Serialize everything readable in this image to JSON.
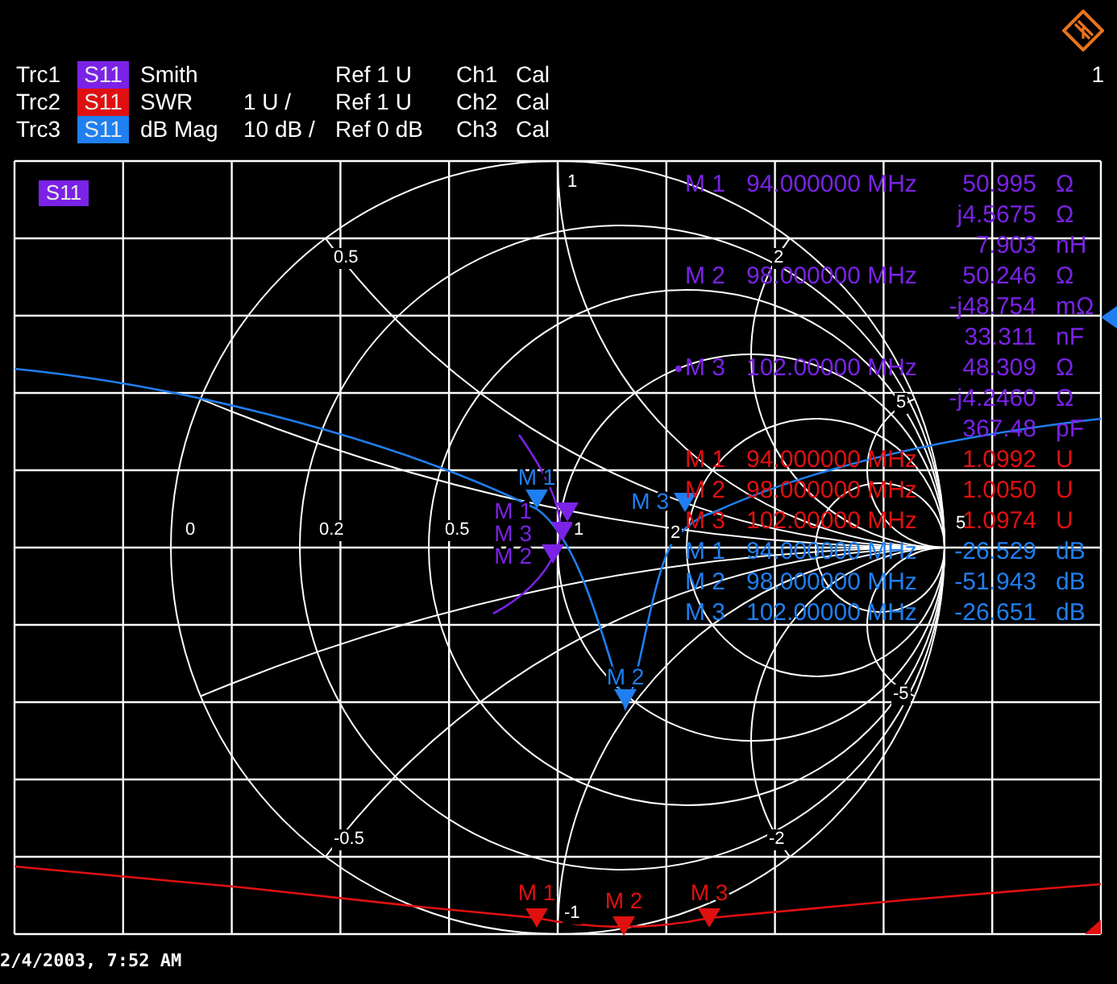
{
  "page_number": "1",
  "traces": [
    {
      "name": "Trc1",
      "parameter": "S11",
      "color": "#7a22e6",
      "format": "Smith",
      "ref": "Ref 1 U",
      "channel": "Ch1",
      "cal": "Cal",
      "kind": "smith",
      "markers": [
        {
          "label": "M 1"
        },
        {
          "label": "M 3"
        },
        {
          "label": "M 2"
        }
      ],
      "readout": [
        {
          "marker": "M 1",
          "active": false,
          "frequency": "94.000000 MHz",
          "value": "50.995",
          "unit": "Ω"
        },
        {
          "value": "j4.5675",
          "unit": "Ω"
        },
        {
          "value": "7.903",
          "unit": "nH"
        },
        {
          "marker": "M 2",
          "active": false,
          "frequency": "98.000000 MHz",
          "value": "50.246",
          "unit": "Ω"
        },
        {
          "value": "-j48.754",
          "unit": "mΩ"
        },
        {
          "value": "33.311",
          "unit": "nF"
        },
        {
          "marker": "M 3",
          "active": true,
          "frequency": "102.00000 MHz",
          "value": "48.309",
          "unit": "Ω"
        },
        {
          "value": "-j4.2460",
          "unit": "Ω"
        },
        {
          "value": "367.48",
          "unit": "pF"
        }
      ]
    },
    {
      "name": "Trc2",
      "parameter": "S11",
      "color": "#e01010",
      "format": "SWR",
      "scale": "1 U /",
      "ref": "Ref 1 U",
      "channel": "Ch2",
      "cal": "Cal",
      "kind": "swr",
      "markers": [
        {
          "label": "M 1"
        },
        {
          "label": "M 2"
        },
        {
          "label": "M 3"
        }
      ],
      "readout": [
        {
          "marker": "M 1",
          "active": false,
          "frequency": "94.000000 MHz",
          "value": "1.0992",
          "unit": "U"
        },
        {
          "marker": "M 2",
          "active": false,
          "frequency": "98.000000 MHz",
          "value": "1.0050",
          "unit": "U"
        },
        {
          "marker": "M 3",
          "active": false,
          "frequency": "102.00000 MHz",
          "value": "1.0974",
          "unit": "U"
        }
      ]
    },
    {
      "name": "Trc3",
      "parameter": "S11",
      "color": "#1f7ff0",
      "format": "dB Mag",
      "scale": "10 dB /",
      "ref": "Ref 0 dB",
      "channel": "Ch3",
      "cal": "Cal",
      "kind": "dbmag",
      "markers": [
        {
          "label": "M 1"
        },
        {
          "label": "M 2"
        },
        {
          "label": "M 3"
        }
      ],
      "readout": [
        {
          "marker": "M 1",
          "active": false,
          "frequency": "94.000000 MHz",
          "value": "-26.529",
          "unit": "dB"
        },
        {
          "marker": "M 2",
          "active": false,
          "frequency": "98.000000 MHz",
          "value": "-51.943",
          "unit": "dB"
        },
        {
          "marker": "M 3",
          "active": false,
          "frequency": "102.00000 MHz",
          "value": "-26.651",
          "unit": "dB"
        }
      ]
    }
  ],
  "diagram_tag": "S11",
  "scale_labels": [
    "1",
    "0.5",
    "2",
    "0",
    "0.2",
    "0.5",
    "1",
    "2",
    "5",
    "5",
    "-5",
    "-0.5",
    "-2",
    "-1"
  ],
  "timestamp": "2/4/2003, 7:52 AM"
}
